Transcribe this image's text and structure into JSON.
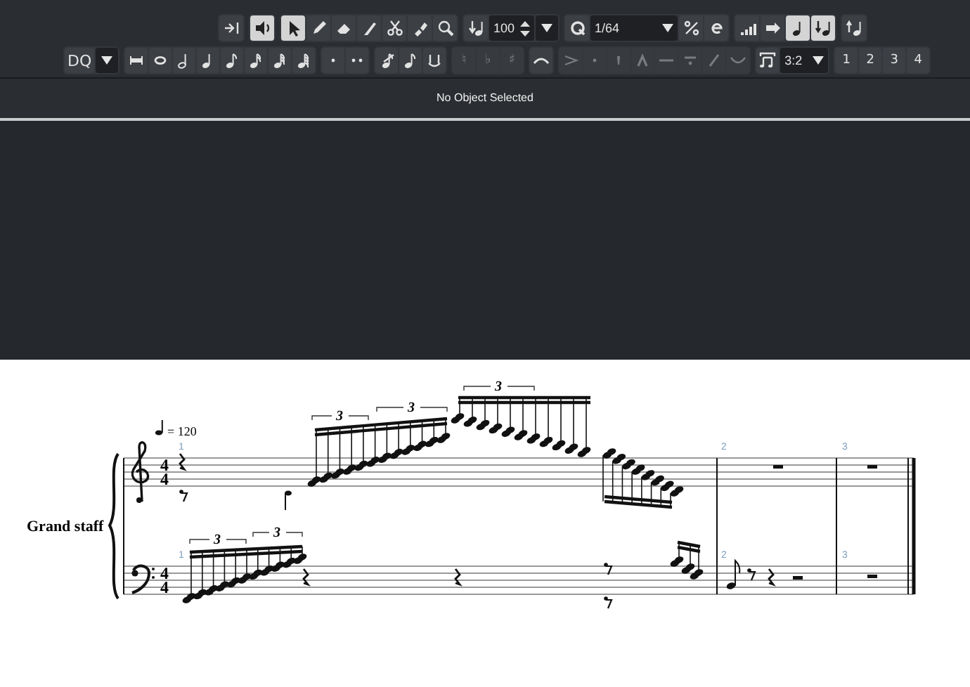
{
  "toolbar": {
    "rows": [
      {
        "groups": [
          {
            "items": [
              {
                "kind": "icon",
                "selected": false
              }
            ]
          },
          {
            "items": [
              {
                "kind": "icon",
                "selected": true
              }
            ]
          },
          {
            "items": [
              {
                "kind": "icon",
                "selected": true
              },
              {
                "kind": "icon",
                "selected": false
              },
              {
                "kind": "icon",
                "selected": false
              },
              {
                "kind": "icon",
                "selected": false
              },
              {
                "kind": "icon",
                "selected": false
              },
              {
                "kind": "icon",
                "selected": false
              },
              {
                "kind": "icon",
                "selected": false
              }
            ]
          },
          {
            "items": [
              {
                "kind": "icon",
                "selected": false
              },
              {
                "kind": "spin",
                "value": "100"
              },
              {
                "kind": "menu"
              }
            ]
          },
          {
            "items": [
              {
                "kind": "icon",
                "selected": false
              },
              {
                "kind": "dropdown",
                "value": "1/64"
              },
              {
                "kind": "icon",
                "selected": false
              },
              {
                "kind": "icon",
                "selected": false
              }
            ]
          },
          {
            "items": [
              {
                "kind": "icon",
                "selected": false
              },
              {
                "kind": "icon",
                "selected": false
              },
              {
                "kind": "icon",
                "selected": true
              },
              {
                "kind": "icon",
                "selected": true
              }
            ]
          },
          {
            "items": [
              {
                "kind": "icon",
                "selected": false
              }
            ]
          }
        ]
      },
      {
        "groups": [
          {
            "items": [
              {
                "kind": "text",
                "label": "DQ"
              },
              {
                "kind": "menu"
              }
            ]
          },
          {
            "items": [
              {
                "kind": "icon",
                "disabled": false
              },
              {
                "kind": "icon",
                "disabled": false
              },
              {
                "kind": "icon",
                "disabled": false
              },
              {
                "kind": "icon",
                "disabled": false
              },
              {
                "kind": "icon",
                "disabled": false
              },
              {
                "kind": "icon",
                "disabled": false
              },
              {
                "kind": "icon",
                "disabled": false
              },
              {
                "kind": "icon",
                "disabled": false
              }
            ]
          },
          {
            "items": [
              {
                "kind": "icon",
                "disabled": false
              },
              {
                "kind": "icon",
                "disabled": false
              }
            ]
          },
          {
            "items": [
              {
                "kind": "icon",
                "disabled": false
              },
              {
                "kind": "icon",
                "disabled": false
              },
              {
                "kind": "icon",
                "disabled": false
              }
            ]
          },
          {
            "items": [
              {
                "kind": "text",
                "label": "♮",
                "disabled": true
              },
              {
                "kind": "text",
                "label": "♭",
                "disabled": true
              },
              {
                "kind": "text",
                "label": "♯",
                "disabled": true
              }
            ]
          },
          {
            "items": [
              {
                "kind": "icon",
                "disabled": false
              }
            ]
          },
          {
            "items": [
              {
                "kind": "icon",
                "disabled": true
              },
              {
                "kind": "icon",
                "disabled": true
              },
              {
                "kind": "icon",
                "disabled": true
              },
              {
                "kind": "icon",
                "disabled": true
              },
              {
                "kind": "icon",
                "disabled": true
              },
              {
                "kind": "icon",
                "disabled": true
              },
              {
                "kind": "icon",
                "disabled": true
              },
              {
                "kind": "icon",
                "disabled": true
              }
            ]
          },
          {
            "items": [
              {
                "kind": "icon",
                "disabled": false
              },
              {
                "kind": "dropdown",
                "value": "3:2"
              }
            ]
          },
          {
            "items": [
              {
                "kind": "text",
                "label": "1"
              },
              {
                "kind": "text",
                "label": "2"
              },
              {
                "kind": "text",
                "label": "3"
              },
              {
                "kind": "text",
                "label": "4"
              }
            ]
          }
        ]
      }
    ]
  },
  "info_line": "No Object Selected",
  "score": {
    "instrument": "Grand staff",
    "tempo": "= 120",
    "staves": [
      {
        "kind": "treble",
        "time_signature": [
          "4",
          "4"
        ],
        "measure_numbers": [
          "1",
          "2",
          "3"
        ],
        "tuplets": [
          "3",
          "3",
          "3"
        ]
      },
      {
        "kind": "bass",
        "time_signature": [
          "4",
          "4"
        ],
        "measure_numbers": [
          "1",
          "2",
          "3"
        ],
        "tuplets": [
          "3",
          "3"
        ]
      }
    ]
  }
}
